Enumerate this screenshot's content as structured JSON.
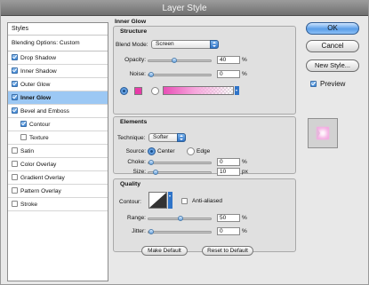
{
  "window": {
    "title": "Layer Style"
  },
  "styles_panel": {
    "header": "Styles",
    "items": [
      {
        "label": "Blending Options: Custom",
        "has_checkbox": false,
        "checked": false,
        "indent": false,
        "selected": false
      },
      {
        "label": "Drop Shadow",
        "has_checkbox": true,
        "checked": true,
        "indent": false,
        "selected": false
      },
      {
        "label": "Inner Shadow",
        "has_checkbox": true,
        "checked": true,
        "indent": false,
        "selected": false
      },
      {
        "label": "Outer Glow",
        "has_checkbox": true,
        "checked": true,
        "indent": false,
        "selected": false
      },
      {
        "label": "Inner Glow",
        "has_checkbox": true,
        "checked": true,
        "indent": false,
        "selected": true
      },
      {
        "label": "Bevel and Emboss",
        "has_checkbox": true,
        "checked": true,
        "indent": false,
        "selected": false
      },
      {
        "label": "Contour",
        "has_checkbox": true,
        "checked": true,
        "indent": true,
        "selected": false
      },
      {
        "label": "Texture",
        "has_checkbox": true,
        "checked": false,
        "indent": true,
        "selected": false
      },
      {
        "label": "Satin",
        "has_checkbox": true,
        "checked": false,
        "indent": false,
        "selected": false
      },
      {
        "label": "Color Overlay",
        "has_checkbox": true,
        "checked": false,
        "indent": false,
        "selected": false
      },
      {
        "label": "Gradient Overlay",
        "has_checkbox": true,
        "checked": false,
        "indent": false,
        "selected": false
      },
      {
        "label": "Pattern Overlay",
        "has_checkbox": true,
        "checked": false,
        "indent": false,
        "selected": false
      },
      {
        "label": "Stroke",
        "has_checkbox": true,
        "checked": false,
        "indent": false,
        "selected": false
      }
    ]
  },
  "inner_glow": {
    "title": "Inner Glow",
    "structure": {
      "title": "Structure",
      "blend_mode_label": "Blend Mode:",
      "blend_mode_value": "Screen",
      "opacity_label": "Opacity:",
      "opacity_value": "40",
      "opacity_level": 0.4,
      "opacity_unit": "%",
      "noise_label": "Noise:",
      "noise_value": "0",
      "noise_level": 0.0,
      "noise_unit": "%",
      "color_swatch": "#e83aa8",
      "gradient_from": "#e84fb6"
    },
    "elements": {
      "title": "Elements",
      "technique_label": "Technique:",
      "technique_value": "Softer",
      "source_label": "Source:",
      "source_center": "Center",
      "source_edge": "Edge",
      "source_selected": "Center",
      "choke_label": "Choke:",
      "choke_value": "0",
      "choke_level": 0.0,
      "choke_unit": "%",
      "size_label": "Size:",
      "size_value": "10",
      "size_level": 0.08,
      "size_unit": "px"
    },
    "quality": {
      "title": "Quality",
      "contour_label": "Contour:",
      "anti_aliased_label": "Anti-aliased",
      "anti_aliased_checked": false,
      "range_label": "Range:",
      "range_value": "50",
      "range_level": 0.5,
      "range_unit": "%",
      "jitter_label": "Jitter:",
      "jitter_value": "0",
      "jitter_level": 0.0,
      "jitter_unit": "%"
    },
    "make_default_label": "Make Default",
    "reset_default_label": "Reset to Default"
  },
  "actions": {
    "ok_label": "OK",
    "cancel_label": "Cancel",
    "new_style_label": "New Style...",
    "preview_label": "Preview",
    "preview_checked": true
  },
  "colors": {
    "accent": "#3c86d6",
    "selection": "#9cc8f4",
    "glow": "#f3a9e1"
  }
}
